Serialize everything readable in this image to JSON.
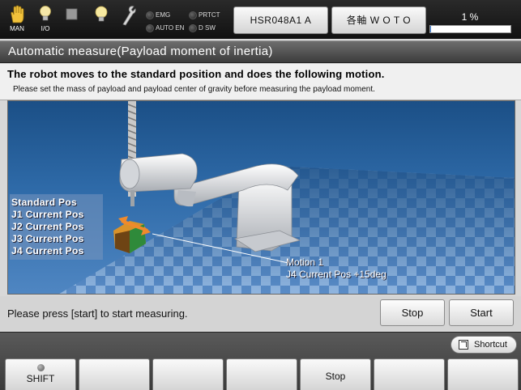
{
  "topbar": {
    "icons": [
      {
        "name": "hand-icon",
        "caption": "MAN"
      },
      {
        "name": "lightbulb-icon",
        "caption": "I/O"
      },
      {
        "name": "stop-square-icon",
        "caption": ""
      },
      {
        "name": "lightbulb-icon",
        "caption": ""
      },
      {
        "name": "wrench-icon",
        "caption": ""
      }
    ],
    "lamps": {
      "emg": "EMG",
      "prtct": "PRTCT",
      "auto_en": "AUTO EN",
      "d_sw": "D SW"
    },
    "robot_button": "HSR048A1 A",
    "axis_button": "各軸  W O T O",
    "progress": {
      "label": "1 %",
      "value": 1
    }
  },
  "title": "Automatic measure(Payload moment of inertia)",
  "instructions": {
    "main": "The robot moves to the standard position and does the following motion.",
    "sub": "Please set the mass of payload and payload center of gravity before measuring the payload moment."
  },
  "viewport": {
    "position_list": [
      "Standard Pos",
      "J1 Current Pos",
      "J2 Current Pos",
      "J3 Current Pos",
      "J4 Current Pos"
    ],
    "motion": {
      "title": "Motion 1",
      "description": "J4 Current Pos +15deg"
    }
  },
  "actions": {
    "message": "Please press [start] to start measuring.",
    "stop_label": "Stop",
    "start_label": "Start"
  },
  "bottom": {
    "shortcut_label": "Shortcut",
    "fkeys": [
      "SHIFT",
      "",
      "",
      "",
      "Stop",
      "",
      ""
    ]
  }
}
